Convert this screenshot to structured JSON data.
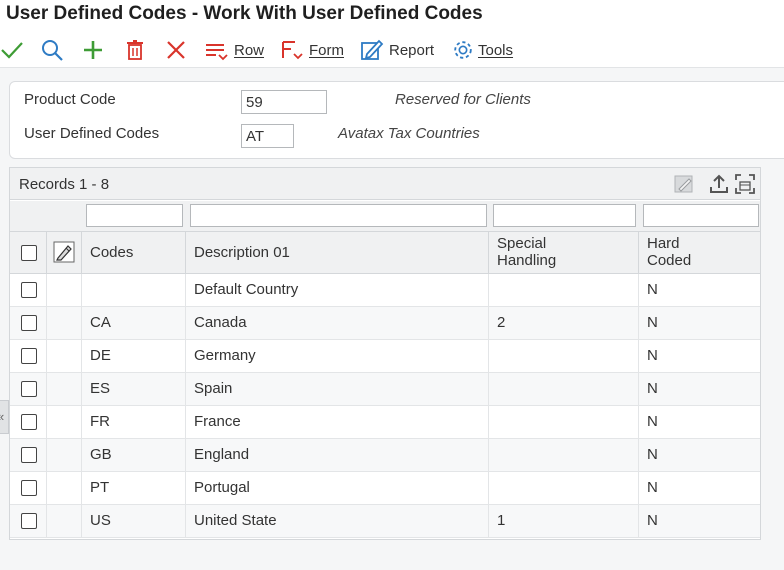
{
  "window": {
    "title": "User Defined Codes - Work With User Defined Codes"
  },
  "toolbar": {
    "row_label": "Row",
    "form_label": "Form",
    "report_label": "Report",
    "tools_label": "Tools",
    "colors": {
      "ok": "#3e9c35",
      "search": "#2e7bc4",
      "add": "#3e9c35",
      "delete": "#d9342b",
      "close": "#d9342b",
      "exit": "#d9342b",
      "report": "#2e7bc4",
      "tools": "#2e7bc4"
    }
  },
  "header": {
    "product_code": {
      "label": "Product Code",
      "value": "59",
      "description": "Reserved for Clients"
    },
    "user_defined_codes": {
      "label": "User Defined Codes",
      "value": "AT",
      "description": "Avatax Tax Countries"
    }
  },
  "grid": {
    "records_label": "Records 1 - 8",
    "columns": {
      "codes": "Codes",
      "description": "Description 01",
      "special_handling": "Special Handling",
      "hard_coded": "Hard Coded"
    },
    "rows": [
      {
        "code": "",
        "description": "Default Country",
        "special_handling": "",
        "hard_coded": "N"
      },
      {
        "code": "CA",
        "description": "Canada",
        "special_handling": "2",
        "hard_coded": "N"
      },
      {
        "code": "DE",
        "description": "Germany",
        "special_handling": "",
        "hard_coded": "N"
      },
      {
        "code": "ES",
        "description": "Spain",
        "special_handling": "",
        "hard_coded": "N"
      },
      {
        "code": "FR",
        "description": "France",
        "special_handling": "",
        "hard_coded": "N"
      },
      {
        "code": "GB",
        "description": "England",
        "special_handling": "",
        "hard_coded": "N"
      },
      {
        "code": "PT",
        "description": "Portugal",
        "special_handling": "",
        "hard_coded": "N"
      },
      {
        "code": "US",
        "description": "United State",
        "special_handling": "1",
        "hard_coded": "N"
      }
    ]
  },
  "side_tab": {
    "glyph": "«"
  }
}
